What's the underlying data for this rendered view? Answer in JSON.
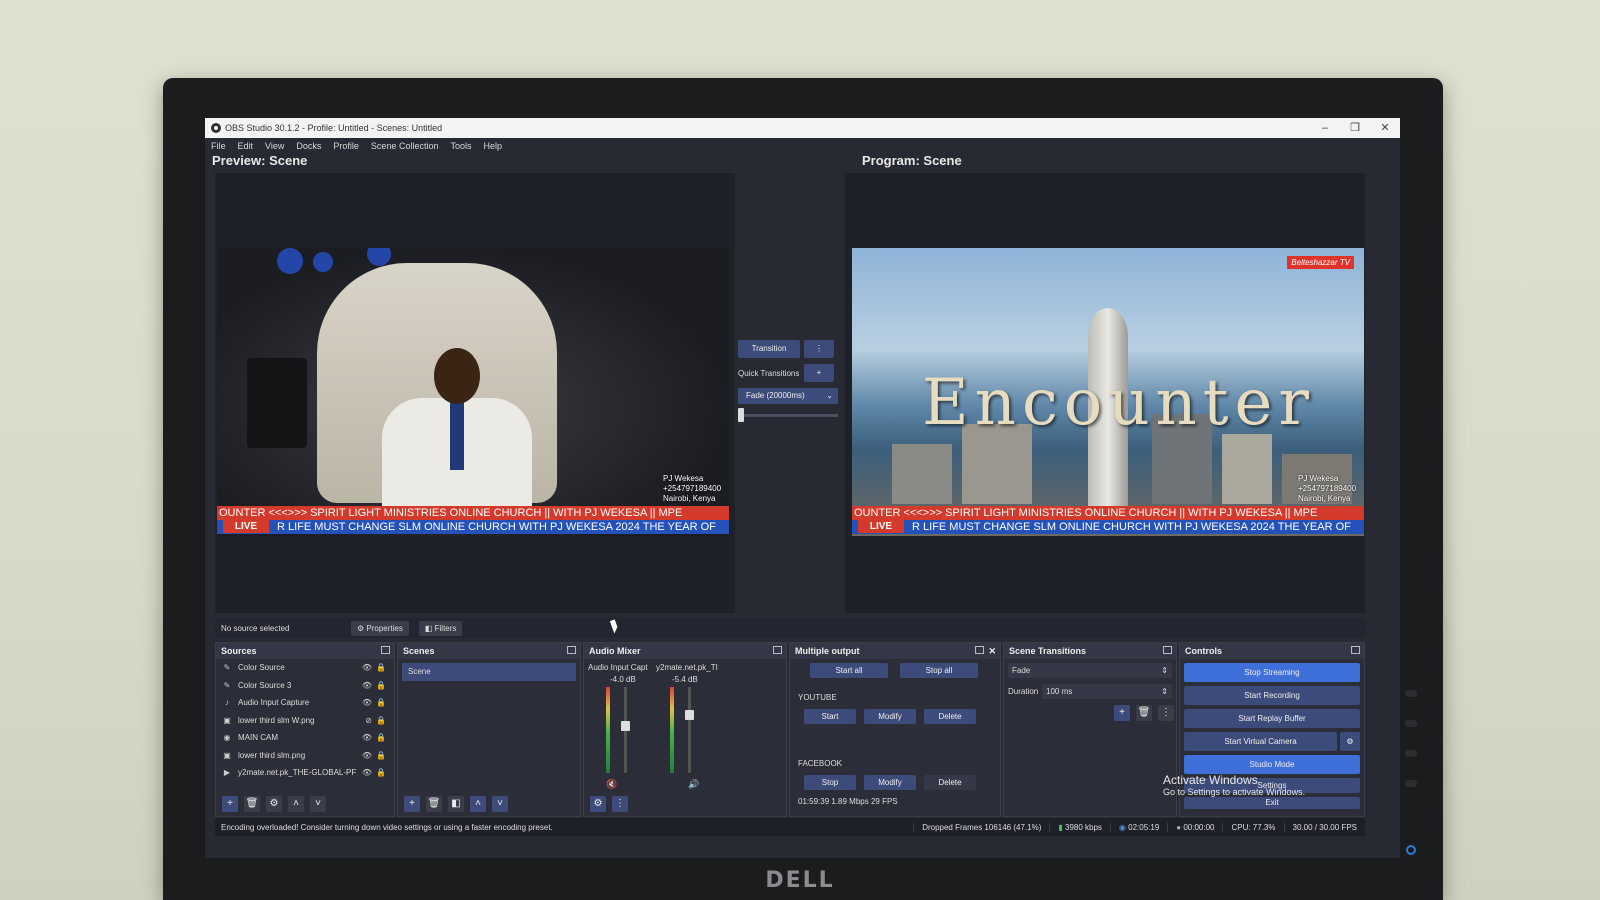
{
  "window": {
    "title": "OBS Studio 30.1.2 - Profile: Untitled - Scenes: Untitled",
    "controls": [
      "–",
      "❐",
      "✕"
    ]
  },
  "menu": [
    "File",
    "Edit",
    "View",
    "Docks",
    "Profile",
    "Scene Collection",
    "Tools",
    "Help"
  ],
  "preview": {
    "title": "Preview: Scene",
    "overlay": {
      "name": "PJ Wekesa",
      "phone": "+254797189400",
      "location": "Nairobi, Kenya"
    },
    "ticker_top": "OUNTER  <<<>>>   SPIRIT LIGHT MINISTRIES ONLINE CHURCH  || WITH PJ WEKESA || MPE",
    "ticker_bottom": "R LIFE MUST CHANGE SLM ONLINE CHURCH WITH PJ WEKESA  2024 THE YEAR OF",
    "live": "LIVE"
  },
  "program": {
    "title": "Program: Scene",
    "headline": "Encounter",
    "logo": "Belteshazzar TV",
    "overlay": {
      "name": "PJ Wekesa",
      "phone": "+254797189400",
      "location": "Nairobi, Kenya"
    },
    "ticker_top": "OUNTER  <<<>>>   SPIRIT LIGHT MINISTRIES ONLINE CHURCH  || WITH PJ WEKESA || MPE",
    "ticker_bottom": "R LIFE MUST CHANGE SLM ONLINE CHURCH WITH PJ WEKESA  2024 THE YEAR OF",
    "live": "LIVE"
  },
  "transitions": {
    "transition_label": "Transition",
    "more": "⋮",
    "quick_label": "Quick Transitions",
    "add": "+",
    "selected": "Fade (20000ms)",
    "progress": 0
  },
  "source_bar": {
    "status": "No source selected",
    "properties": "⚙ Properties",
    "filters": "◧ Filters"
  },
  "sources": {
    "title": "Sources",
    "items": [
      {
        "icon": "✎",
        "label": "Color Source"
      },
      {
        "icon": "✎",
        "label": "Color Source 3"
      },
      {
        "icon": "♪",
        "label": "Audio Input Capture"
      },
      {
        "icon": "▣",
        "label": "lower third slm W.png"
      },
      {
        "icon": "◉",
        "label": "MAIN CAM"
      },
      {
        "icon": "▣",
        "label": "lower third slm.png"
      },
      {
        "icon": "▶",
        "label": "y2mate.net.pk_THE-GLOBAL-PF"
      }
    ]
  },
  "scenes": {
    "title": "Scenes",
    "items": [
      "Scene"
    ]
  },
  "audio_mixer": {
    "title": "Audio Mixer",
    "channels": [
      {
        "name": "Audio Input Capt",
        "db": "-4.0 dB",
        "level": 0.55
      },
      {
        "name": "y2mate.net.pk_TI",
        "db": "-5.4 dB",
        "level": 0.7
      }
    ]
  },
  "multiple_output": {
    "title": "Multiple output",
    "start_all": "Start all",
    "stop_all": "Stop all",
    "youtube": "YOUTUBE",
    "facebook": "FACEBOOK",
    "start": "Start",
    "stop": "Stop",
    "modify": "Modify",
    "delete": "Delete",
    "stats": "01:59:39  1.89 Mbps  29 FPS"
  },
  "scene_transitions": {
    "title": "Scene Transitions",
    "selected": "Fade",
    "duration_label": "Duration",
    "duration": "100 ms"
  },
  "controls": {
    "title": "Controls",
    "stop_streaming": "Stop Streaming",
    "start_recording": "Start Recording",
    "start_replay": "Start Replay Buffer",
    "start_virtual": "Start Virtual Camera",
    "studio_mode": "Studio Mode",
    "settings": "Settings",
    "exit": "Exit"
  },
  "activation": {
    "title": "Activate Windows",
    "subtitle": "Go to Settings to activate Windows."
  },
  "status": {
    "message": "Encoding overloaded! Consider turning down video settings or using a faster encoding preset.",
    "dropped": "Dropped Frames 106146 (47.1%)",
    "bitrate": "3980 kbps",
    "stream_time": "02:05:19",
    "rec_time": "00:00:00",
    "cpu": "CPU: 77.3%",
    "fps": "30.00 / 30.00 FPS"
  },
  "brand": "DELL",
  "colors": {
    "accent": "#3c4b7a",
    "highlight": "#3f6fd8",
    "ticker_red": "#d43a2c",
    "ticker_blue": "#2452b8"
  }
}
